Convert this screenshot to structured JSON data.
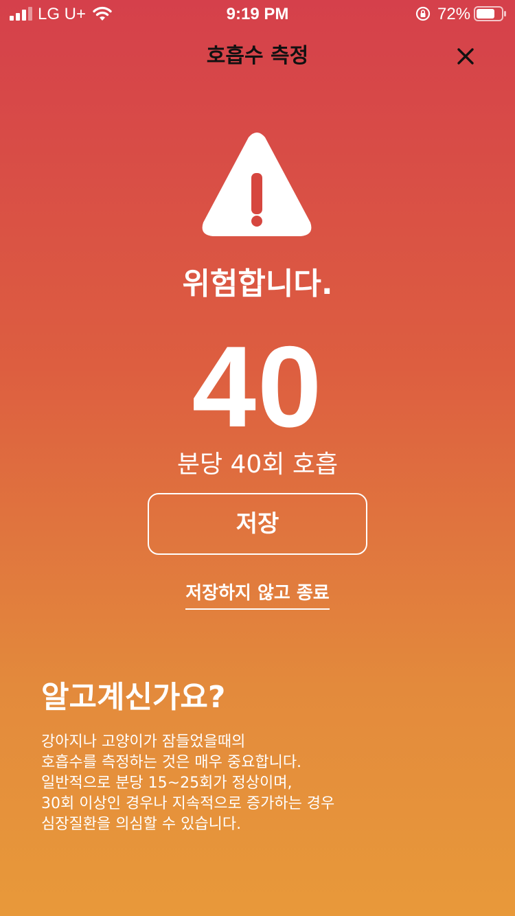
{
  "status_bar": {
    "carrier": "LG U+",
    "time": "9:19 PM",
    "battery": "72%"
  },
  "header": {
    "title": "호흡수 측정",
    "close_icon": "close-icon"
  },
  "result": {
    "warning_icon": "warning-triangle-icon",
    "status": "위험합니다.",
    "count": "40",
    "rate_text": "분당 40회 호흡"
  },
  "actions": {
    "save_label": "저장",
    "exit_label": "저장하지 않고 종료"
  },
  "info": {
    "title": "알고계신가요?",
    "lines": [
      "강아지나 고양이가 잠들었을때의",
      "호흡수를 측정하는 것은 매우 중요합니다.",
      "일반적으로 분당 15~25회가 정상이며,",
      "30회 이상인 경우나 지속적으로 증가하는 경우",
      "심장질환을 의심할 수 있습니다."
    ]
  },
  "colors": {
    "gradient_top": "#d5404b",
    "gradient_bottom": "#e8993a",
    "title_text": "#111111",
    "foreground": "#ffffff"
  }
}
